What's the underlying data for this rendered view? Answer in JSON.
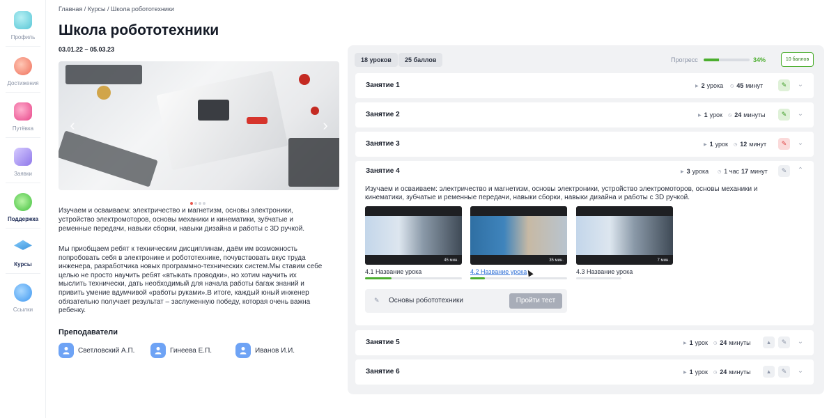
{
  "sidebar": {
    "items": [
      {
        "label": "Профиль",
        "icon": "profile-icon",
        "color": "#6fd3e0"
      },
      {
        "label": "Достижения",
        "icon": "achievements-icon",
        "color": "#f3947c"
      },
      {
        "label": "Путёвка",
        "icon": "voucher-icon",
        "color": "#f06aa0"
      },
      {
        "label": "Заявки",
        "icon": "requests-icon",
        "color": "#a58ff0"
      },
      {
        "label": "Поддержка",
        "icon": "support-icon",
        "color": "#6ed86a"
      },
      {
        "label": "Курсы",
        "icon": "courses-icon",
        "color": "#3b9be0"
      },
      {
        "label": "Ссылки",
        "icon": "links-icon",
        "color": "#4aa4f5"
      }
    ]
  },
  "breadcrumb": {
    "home": "Главная",
    "courses": "Курсы",
    "current": "Школа робототехники",
    "sep": "/"
  },
  "page": {
    "title": "Школа робототехники",
    "dates": "03.01.22 – 05.03.23",
    "desc1": "Изучаем и осваиваем: электричество и магнетизм, основы электроники, устройство электромоторов, основы механики и кинематики, зубчатые и ременные передачи, навыки сборки, навыки дизайна и работы с 3D ручкой.",
    "desc2": "Мы приобщаем ребят к техническим дисциплинам, даём им возможность попробовать себя в электронике и робототехнике, почувствовать вкус труда инженера, разработчика новых программно-технических систем.Мы ставим себе целью не просто научить ребят «втыкать проводки», но хотим научить их мыслить технически, дать необходимый для начала работы багаж знаний и привить умение вдумчивой «работы руками».В итоге, каждый юный инженер обязательно получает результат – заслуженную победу, которая очень важна ребенку."
  },
  "carousel": {
    "slides": 4,
    "active": 0
  },
  "teachers": {
    "title": "Преподаватели",
    "list": [
      "Светловский А.П.",
      "Гинеева Е.П.",
      "Иванов И.И."
    ]
  },
  "course": {
    "lessons_chip": "18 уроков",
    "points_chip": "25 баллов",
    "progress_label": "Прогресс",
    "progress_value": 34,
    "progress_text": "34%",
    "score_button": "10 баллов",
    "accent": "#4cae2f"
  },
  "lessons": [
    {
      "title": "Занятие 1",
      "count": "2",
      "count_unit": "урока",
      "time": "45",
      "time_unit": "минут",
      "status": "green"
    },
    {
      "title": "Занятие 2",
      "count": "1",
      "count_unit": "урок",
      "time": "24",
      "time_unit": "минуты",
      "status": "green"
    },
    {
      "title": "Занятие 3",
      "count": "1",
      "count_unit": "урок",
      "time": "12",
      "time_unit": "минут",
      "status": "red"
    },
    {
      "title": "Занятие 4",
      "count": "3",
      "count_unit": "урока",
      "time_pre": "1 час",
      "time": "17",
      "time_unit": "минут",
      "status": "gray",
      "desc": "Изучаем и осваиваем: электричество и магнетизм, основы электроники, устройство электромоторов, основы механики и кинематики, зубчатые и ременные передачи, навыки сборки, навыки дизайна и работы с 3D ручкой.",
      "videos": [
        {
          "title": "4.1 Название урока",
          "duration": "45 мин.",
          "progress": 0.27
        },
        {
          "title": "4.2 Название урока",
          "duration": "35 мин.",
          "progress": 0.15
        },
        {
          "title": "4.3 Название урока",
          "duration": "7 мин.",
          "progress": 0
        }
      ],
      "test": {
        "title": "Основы робототехники",
        "button": "Пройти тест"
      }
    },
    {
      "title": "Занятие 5",
      "count": "1",
      "count_unit": "урок",
      "time": "24",
      "time_unit": "минуты",
      "status": "gray"
    },
    {
      "title": "Занятие 6",
      "count": "1",
      "count_unit": "урок",
      "time": "24",
      "time_unit": "минуты",
      "status": "gray"
    }
  ]
}
